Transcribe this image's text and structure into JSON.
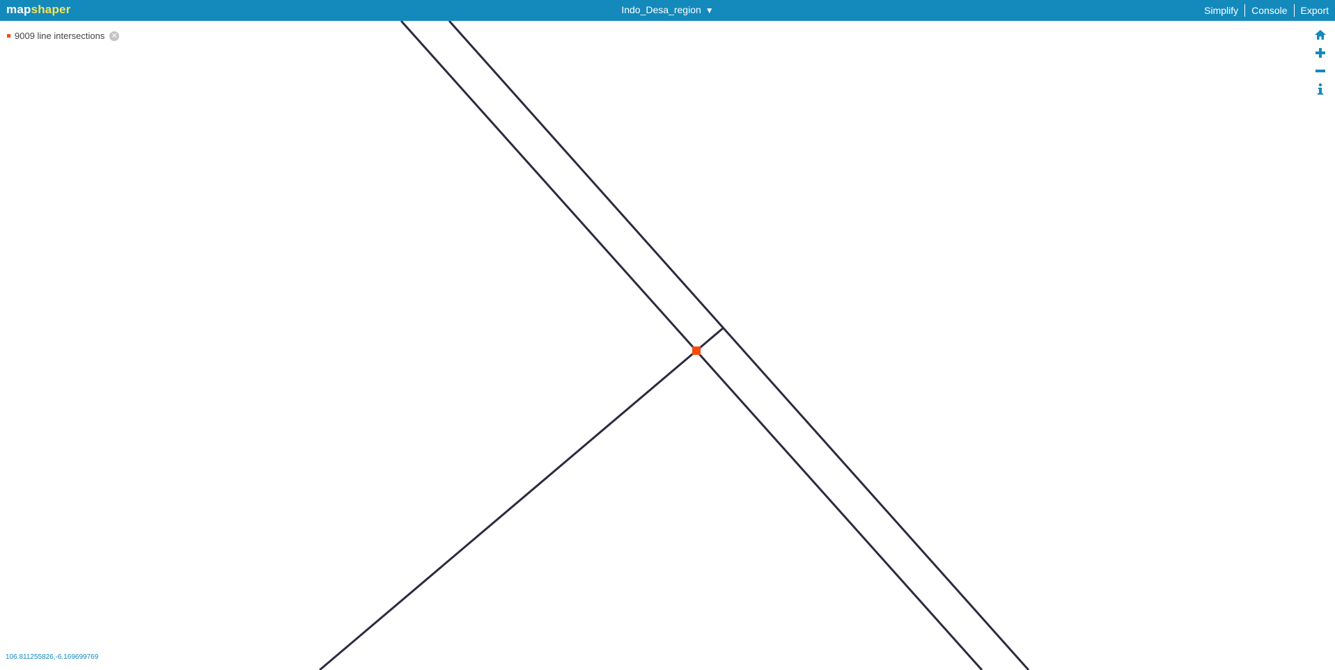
{
  "header": {
    "logo_part1": "map",
    "logo_part2": "shaper",
    "layer_name": "Indo_Desa_region",
    "layer_menu_icon": "triangle-down-icon",
    "menu": [
      "Simplify",
      "Console",
      "Export"
    ]
  },
  "intersections": {
    "label": "9009 line intersections",
    "close_icon": "close-circle-icon"
  },
  "nav_icons": [
    "home-icon",
    "zoom-in-icon",
    "zoom-out-icon",
    "info-icon"
  ],
  "coordinates": "106.811255826,-6.169699769",
  "colors": {
    "header_bg": "#1489bc",
    "logo_accent": "#f6e45c",
    "line": "#2b2b3f",
    "intersection": "#f74b09"
  }
}
